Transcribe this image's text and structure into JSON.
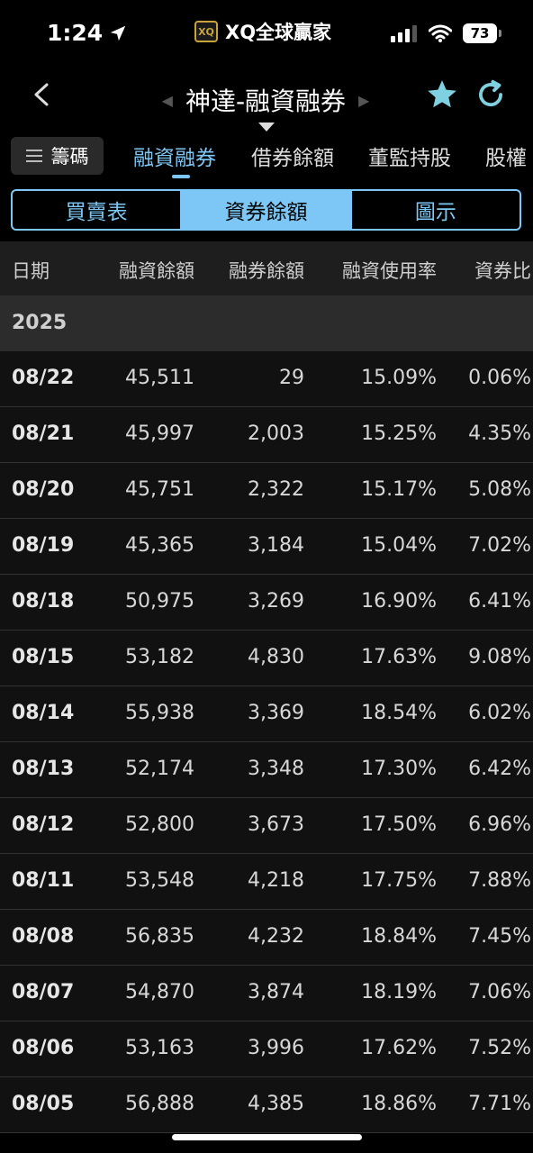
{
  "status": {
    "time": "1:24",
    "app_name": "XQ全球贏家",
    "logo_text": "XQ",
    "battery": "73"
  },
  "header": {
    "title": "神達-融資融券"
  },
  "tabs": {
    "chips_label": "籌碼",
    "items": [
      "融資融券",
      "借券餘額",
      "董監持股",
      "股權"
    ]
  },
  "segments": [
    "買賣表",
    "資券餘額",
    "圖示"
  ],
  "table": {
    "columns": [
      "日期",
      "融資餘額",
      "融券餘額",
      "融資使用率",
      "資券比"
    ],
    "year": "2025",
    "rows": [
      {
        "date": "08/22",
        "margin": "45,511",
        "short": "29",
        "usage": "15.09%",
        "ratio": "0.06%"
      },
      {
        "date": "08/21",
        "margin": "45,997",
        "short": "2,003",
        "usage": "15.25%",
        "ratio": "4.35%"
      },
      {
        "date": "08/20",
        "margin": "45,751",
        "short": "2,322",
        "usage": "15.17%",
        "ratio": "5.08%"
      },
      {
        "date": "08/19",
        "margin": "45,365",
        "short": "3,184",
        "usage": "15.04%",
        "ratio": "7.02%"
      },
      {
        "date": "08/18",
        "margin": "50,975",
        "short": "3,269",
        "usage": "16.90%",
        "ratio": "6.41%"
      },
      {
        "date": "08/15",
        "margin": "53,182",
        "short": "4,830",
        "usage": "17.63%",
        "ratio": "9.08%"
      },
      {
        "date": "08/14",
        "margin": "55,938",
        "short": "3,369",
        "usage": "18.54%",
        "ratio": "6.02%"
      },
      {
        "date": "08/13",
        "margin": "52,174",
        "short": "3,348",
        "usage": "17.30%",
        "ratio": "6.42%"
      },
      {
        "date": "08/12",
        "margin": "52,800",
        "short": "3,673",
        "usage": "17.50%",
        "ratio": "6.96%"
      },
      {
        "date": "08/11",
        "margin": "53,548",
        "short": "4,218",
        "usage": "17.75%",
        "ratio": "7.88%"
      },
      {
        "date": "08/08",
        "margin": "56,835",
        "short": "4,232",
        "usage": "18.84%",
        "ratio": "7.45%"
      },
      {
        "date": "08/07",
        "margin": "54,870",
        "short": "3,874",
        "usage": "18.19%",
        "ratio": "7.06%"
      },
      {
        "date": "08/06",
        "margin": "53,163",
        "short": "3,996",
        "usage": "17.62%",
        "ratio": "7.52%"
      },
      {
        "date": "08/05",
        "margin": "56,888",
        "short": "4,385",
        "usage": "18.86%",
        "ratio": "7.71%"
      }
    ]
  },
  "colors": {
    "accent": "#7cc7f5",
    "star": "#7fd0e0",
    "background": "#000000"
  }
}
